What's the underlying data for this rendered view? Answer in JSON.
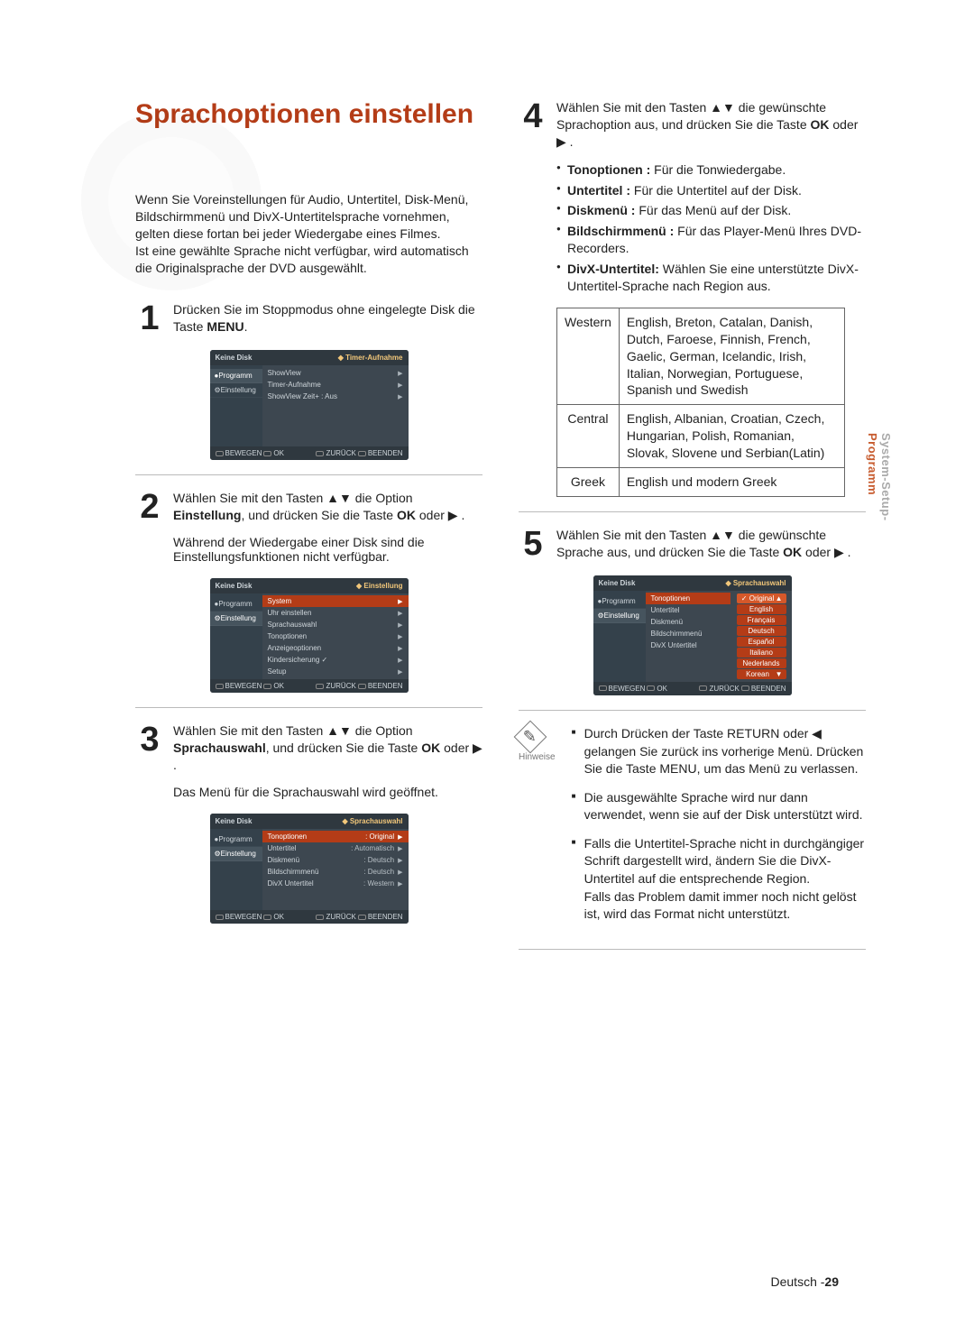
{
  "page": {
    "title": "Sprachoptionen einstellen",
    "intro": "Wenn Sie Voreinstellungen für Audio, Untertitel, Disk-Menü, Bildschirmmenü und DivX-Untertitelsprache vornehmen, gelten diese fortan bei jeder Wiedergabe eines Filmes.\nIst eine gewählte Sprache nicht verfügbar, wird automatisch die Originalsprache der DVD ausgewählt.",
    "footer_lang": "Deutsch -",
    "footer_page": "29",
    "side_tab_top": "System-Setup-",
    "side_tab_bottom": "Programm"
  },
  "steps": {
    "s1": {
      "num": "1",
      "text_a": "Drücken Sie im Stoppmodus ohne",
      "text_b": "eingelegte Disk die Taste ",
      "text_c": "MENU",
      "text_d": "."
    },
    "s2": {
      "num": "2",
      "text_a": "Wählen Sie mit den Tasten ▲▼ die Option",
      "text_b": "Einstellung",
      "text_c": ", und drücken Sie die Taste ",
      "text_d": "OK",
      "text_e": " oder ▶ .",
      "note": "Während der Wiedergabe einer Disk sind die Einstellungsfunktionen nicht verfügbar."
    },
    "s3": {
      "num": "3",
      "text_a": "Wählen Sie mit den Tasten ▲▼ die Option",
      "text_b": "Sprachauswahl",
      "text_c": ", und drücken Sie die Taste",
      "text_d": "OK",
      "text_e": " oder ▶ .",
      "note": "Das Menü für die Sprachauswahl wird geöffnet."
    },
    "s4": {
      "num": "4",
      "text_a": "Wählen Sie mit den Tasten ▲▼ die",
      "text_b": "gewünschte Sprachoption aus, und drücken",
      "text_c": "Sie die Taste ",
      "text_d": "OK",
      "text_e": " oder ▶ ."
    },
    "s5": {
      "num": "5",
      "text_a": "Wählen Sie mit den Tasten ▲▼ die",
      "text_b": "gewünschte Sprache aus, und drücken Sie",
      "text_c": "die Taste ",
      "text_d": "OK",
      "text_e": " oder ▶ ."
    }
  },
  "option_bullets": [
    {
      "b": "Tonoptionen :",
      "t": " Für die Tonwiedergabe."
    },
    {
      "b": "Untertitel :",
      "t": " Für die Untertitel auf der Disk."
    },
    {
      "b": "Diskmenü :",
      "t": " Für das Menü auf der Disk."
    },
    {
      "b": "Bildschirmmenü :",
      "t": " Für das Player-Menü Ihres DVD-Recorders."
    },
    {
      "b": "DivX-Untertitel:",
      "t": " Wählen Sie eine unterstützte DivX-Untertitel-Sprache nach Region aus."
    }
  ],
  "lang_table": {
    "rows": [
      {
        "k": "Western",
        "v": "English, Breton, Catalan, Danish, Dutch, Faroese, Finnish, French, Gaelic, German, Icelandic, Irish, Italian, Norwegian, Portuguese, Spanish und Swedish"
      },
      {
        "k": "Central",
        "v": "English, Albanian, Croatian, Czech, Hungarian, Polish, Romanian, Slovak, Slovene und Serbian(Latin)"
      },
      {
        "k": "Greek",
        "v": "English und modern Greek"
      }
    ]
  },
  "hints": {
    "label": "Hinweise",
    "items": [
      "Durch Drücken der Taste RETURN oder ◀ gelangen Sie zurück ins vorherige Menü. Drücken Sie die Taste MENU, um das Menü zu verlassen.",
      "Die ausgewählte Sprache wird nur dann verwendet, wenn sie auf der Disk unterstützt wird.",
      "Falls die Untertitel-Sprache nicht in durchgängiger Schrift dargestellt wird, ändern Sie die DivX-Untertitel auf die entsprechende Region.\nFalls das Problem damit immer noch nicht gelöst ist, wird das Format nicht unterstützt."
    ]
  },
  "osd": {
    "common": {
      "bottom_move": "BEWEGEN",
      "bottom_ok": "OK",
      "bottom_back": "ZURÜCK",
      "bottom_exit": "BEENDEN",
      "side_programm": "Programm",
      "side_einstellung": "Einstellung",
      "keine_disk": "Keine Disk"
    },
    "m1": {
      "crumb": "Timer-Aufnahme",
      "rows": [
        {
          "k": "ShowView"
        },
        {
          "k": "Timer-Aufnahme"
        },
        {
          "k": "ShowView Zeit+ : Aus"
        }
      ]
    },
    "m2": {
      "crumb": "Einstellung",
      "rows": [
        {
          "k": "System",
          "hl": true
        },
        {
          "k": "Uhr einstellen"
        },
        {
          "k": "Sprachauswahl"
        },
        {
          "k": "Tonoptionen"
        },
        {
          "k": "Anzeigeoptionen"
        },
        {
          "k": "Kindersicherung ✓"
        },
        {
          "k": "Setup"
        }
      ]
    },
    "m3": {
      "crumb": "Sprachauswahl",
      "rows": [
        {
          "k": "Tonoptionen",
          "v": ": Original",
          "hl": true
        },
        {
          "k": "Untertitel",
          "v": ": Automatisch"
        },
        {
          "k": "Diskmenü",
          "v": ": Deutsch"
        },
        {
          "k": "Bildschirmmenü",
          "v": ": Deutsch"
        },
        {
          "k": "DivX Untertitel",
          "v": ": Western"
        }
      ]
    },
    "m5": {
      "crumb": "Sprachauswahl",
      "left_rows": [
        "Tonoptionen",
        "Untertitel",
        "Diskmenü",
        "Bildschirmmenü",
        "DivX Untertitel"
      ],
      "opts": [
        "Original",
        "English",
        "Français",
        "Deutsch",
        "Español",
        "Italiano",
        "Nederlands",
        "Korean"
      ],
      "opt_sel": 0
    }
  }
}
